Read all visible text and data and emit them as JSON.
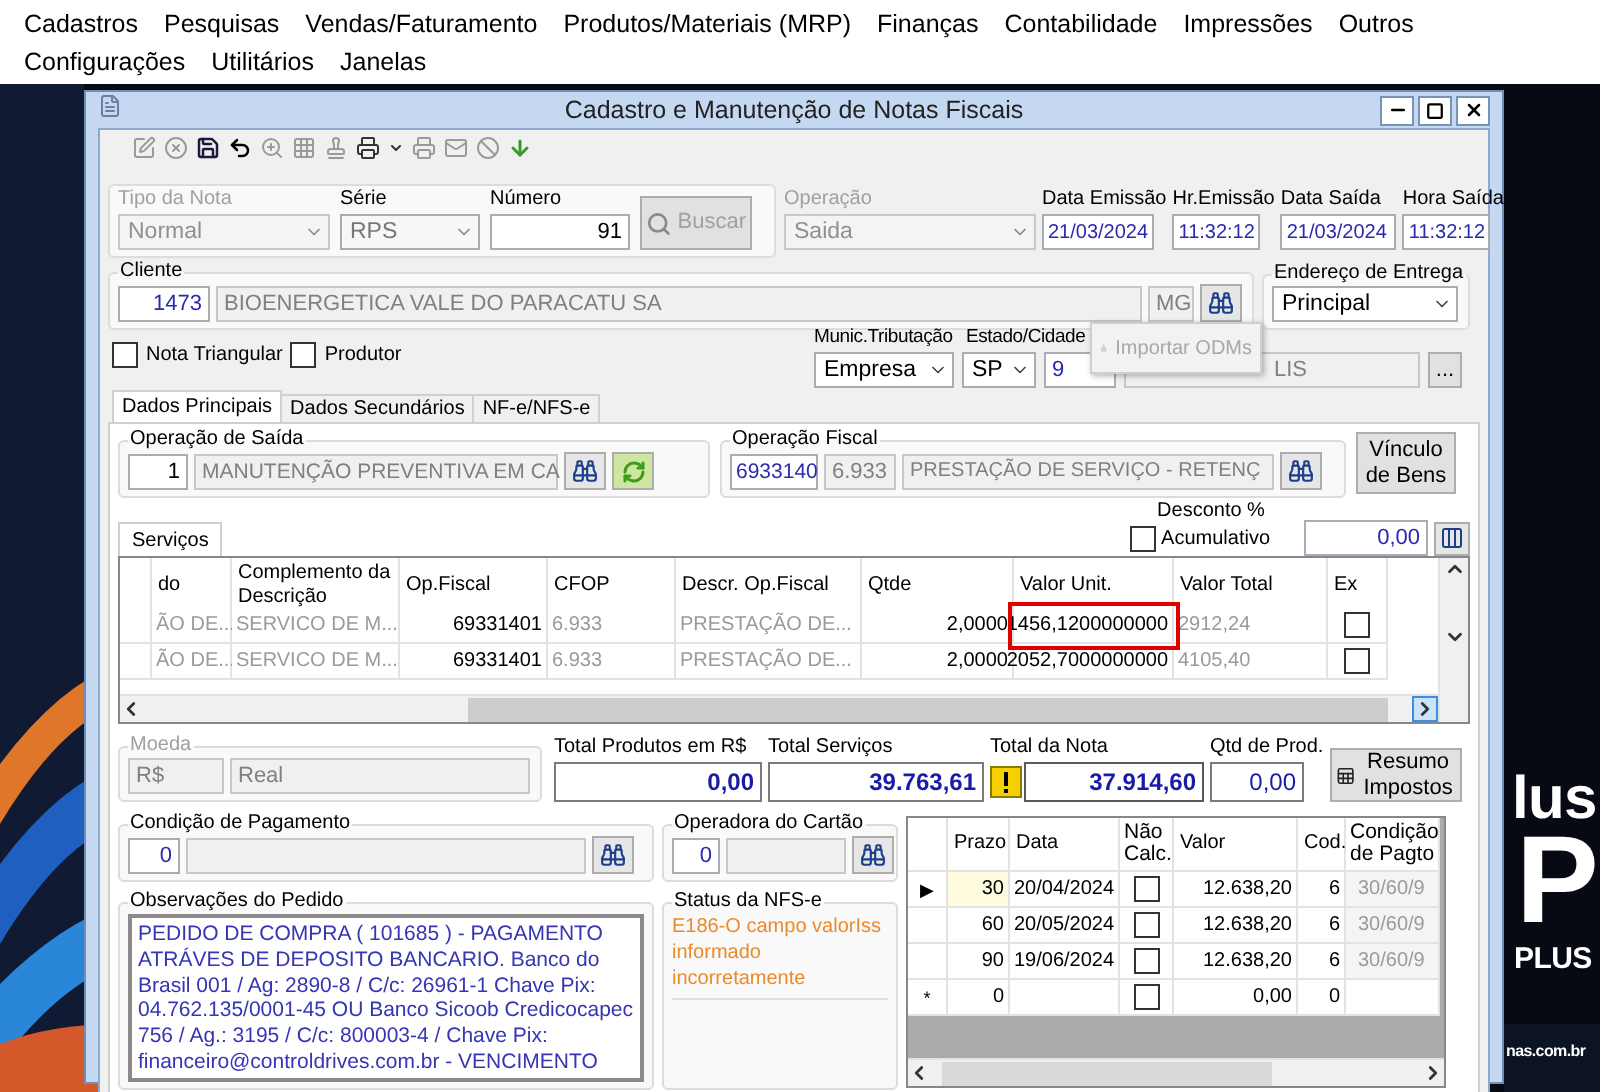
{
  "menu_rows": [
    [
      {
        "label": "Cadastros"
      },
      {
        "label": "Pesquisas"
      },
      {
        "label": "Vendas/Faturamento"
      },
      {
        "label": "Produtos/Materiais (MRP)"
      },
      {
        "label": "Finanças"
      },
      {
        "label": "Contabilidade"
      },
      {
        "label": "Impressões"
      },
      {
        "label": "Outros"
      }
    ],
    [
      {
        "label": "Configurações"
      },
      {
        "label": "Utilitários"
      },
      {
        "label": "Janelas"
      }
    ]
  ],
  "background": {
    "texts": [
      "lus",
      "P",
      "PLUS",
      "nas.com.br"
    ]
  },
  "window": {
    "title": "Cadastro e Manutenção de Notas Fiscais"
  },
  "header": {
    "tipo_nota": {
      "label": "Tipo da Nota",
      "value": "Normal",
      "disabled": true
    },
    "serie": {
      "label": "Série",
      "value": "RPS"
    },
    "numero": {
      "label": "Número",
      "value": "91"
    },
    "buscar": {
      "label": "Buscar",
      "disabled": true
    },
    "operacao": {
      "label": "Operação",
      "value": "Saida",
      "disabled": true
    },
    "dates": [
      {
        "label": "Data Emissão",
        "value": "21/03/2024"
      },
      {
        "label": "Hr.Emissão",
        "value": "11:32:12"
      },
      {
        "label": "Data Saída",
        "value": "21/03/2024"
      },
      {
        "label": "Hora Saída",
        "value": "11:32:12"
      }
    ]
  },
  "cliente": {
    "label": "Cliente",
    "code": "1473",
    "name": "BIOENERGETICA VALE DO PARACATU SA",
    "uf": "MG"
  },
  "endereco_entrega": {
    "label": "Endereço de Entrega",
    "value": "Principal"
  },
  "options": [
    {
      "label": "Nota Triangular",
      "checked": false
    },
    {
      "label": "Produtor",
      "checked": false
    }
  ],
  "tributacao": {
    "munic_label": "Munic.Tributação",
    "munic_value": "Empresa",
    "estado_label": "Estado/Cidade",
    "estado_value": "SP",
    "cidade_code": "9",
    "cidade_name": "LIS",
    "lookup": "..."
  },
  "popup": {
    "label": "Importar ODMs",
    "disabled": true
  },
  "tabs": [
    {
      "label": "Dados Principais",
      "selected": true
    },
    {
      "label": "Dados Secundários",
      "selected": false
    },
    {
      "label": "NF-e/NFS-e",
      "selected": false
    }
  ],
  "operacao_saida": {
    "label": "Operação de Saída",
    "code": "1",
    "name": "MANUTENÇÃO PREVENTIVA EM CA"
  },
  "operacao_fiscal": {
    "label": "Operação Fiscal",
    "code": "6933140",
    "cfop": "6.933",
    "name": "PRESTAÇÃO DE SERVIÇO - RETENÇ"
  },
  "vinculo_button": "Vínculo de Bens",
  "services": {
    "tab": {
      "label": "Serviços",
      "selected": true
    },
    "desconto_label": "Desconto %",
    "acumulativo": {
      "label": "Acumulativo",
      "checked": false
    },
    "desconto_value": "0,00",
    "columns": [
      {
        "label": "do",
        "readonly": true
      },
      {
        "label": "Complemento da Descrição",
        "readonly": true
      },
      {
        "label": "Op.Fiscal",
        "readonly": false
      },
      {
        "label": "CFOP",
        "readonly": true
      },
      {
        "label": "Descr. Op.Fiscal",
        "readonly": true
      },
      {
        "label": "Qtde",
        "readonly": false
      },
      {
        "label": "Valor Unit.",
        "readonly": false,
        "marked": true
      },
      {
        "label": "Valor Total",
        "readonly": true
      },
      {
        "label": "Ex",
        "readonly": false
      }
    ],
    "rows": [
      {
        "cells": [
          "ÃO DE...",
          "SERVICO DE M...",
          "69331401",
          "6.933",
          "PRESTAÇÃO DE...",
          "2,0000",
          "1456,1200000000",
          "2912,24"
        ],
        "ex": false,
        "marked": true
      },
      {
        "cells": [
          "ÃO DE...",
          "SERVICO DE M...",
          "69331401",
          "6.933",
          "PRESTAÇÃO DE...",
          "2,0000",
          "2052,7000000000",
          "4105,40"
        ],
        "ex": false,
        "marked": false
      }
    ]
  },
  "moeda": {
    "label": "Moeda",
    "code": "R$",
    "name": "Real"
  },
  "totals": [
    {
      "label": "Total Produtos em R$",
      "value": "0,00",
      "warning": false
    },
    {
      "label": "Total Serviços",
      "value": "39.763,61",
      "warning": false
    },
    {
      "label": "Total da Nota",
      "value": "37.914,60",
      "warning": true
    },
    {
      "label": "Qtd de Prod.",
      "value": "0,00",
      "warning": false
    }
  ],
  "resumo_button": "Resumo Impostos",
  "pagamento": {
    "label": "Condição de Pagamento",
    "code": "0"
  },
  "operadora": {
    "label": "Operadora do Cartão",
    "code": "0"
  },
  "observacoes": {
    "label": "Observações do Pedido",
    "text": "PEDIDO DE COMPRA ( 101685 ) - PAGAMENTO ATRÁVES DE DEPOSITO BANCARIO. Banco do Brasil 001 /  Ag: 2890-8 / C/c: 26961-1 Chave Pix: 04.762.135/0001-45 OU Banco Sicoob Credicocapec 756 / Ag.: 3195 /  C/c: 800003-4 / Chave Pix: financeiro@controldrives.com.br - VENCIMENTO"
  },
  "status_nfse": {
    "label": "Status da NFS-e",
    "text": "E186-O campo valorIss informado incorretamente"
  },
  "parcelas": {
    "columns": [
      "Prazo",
      "Data",
      "Não Calc.",
      "Valor",
      "Cod.",
      "Condição de Pagto"
    ],
    "rows": [
      {
        "marker": "▶",
        "selected": true,
        "prazo": "30",
        "data": "20/04/2024",
        "nao_calc": false,
        "valor": "12.638,20",
        "cod": "6",
        "condicao": "30/60/9"
      },
      {
        "selected": false,
        "prazo": "60",
        "data": "20/05/2024",
        "nao_calc": false,
        "valor": "12.638,20",
        "cod": "6",
        "condicao": "30/60/9"
      },
      {
        "selected": false,
        "prazo": "90",
        "data": "19/06/2024",
        "nao_calc": false,
        "valor": "12.638,20",
        "cod": "6",
        "condicao": "30/60/9"
      },
      {
        "marker": "*",
        "selected": false,
        "prazo": "0",
        "nao_calc": false,
        "valor": "0,00",
        "cod": "0"
      }
    ]
  }
}
